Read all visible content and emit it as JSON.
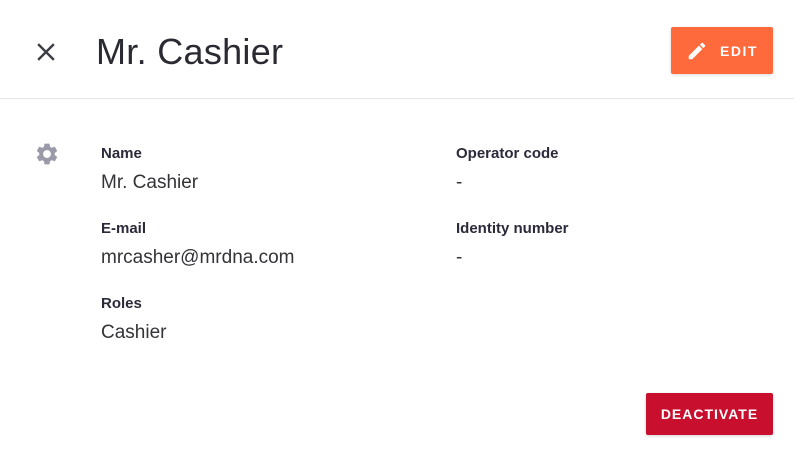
{
  "header": {
    "title": "Mr. Cashier",
    "edit_label": "EDIT"
  },
  "icons": {
    "close": "close-icon",
    "edit": "pencil-icon",
    "settings": "gear-icon"
  },
  "details": {
    "name": {
      "label": "Name",
      "value": "Mr. Cashier"
    },
    "email": {
      "label": "E-mail",
      "value": "mrcasher@mrdna.com"
    },
    "roles": {
      "label": "Roles",
      "value": "Cashier"
    },
    "operator_code": {
      "label": "Operator code",
      "value": "-"
    },
    "identity_number": {
      "label": "Identity number",
      "value": "-"
    }
  },
  "footer": {
    "deactivate_label": "DEACTIVATE"
  },
  "colors": {
    "edit_button": "#ff6a3d",
    "deactivate_button": "#c8102e",
    "icon_gray": "#9a9aa8"
  }
}
